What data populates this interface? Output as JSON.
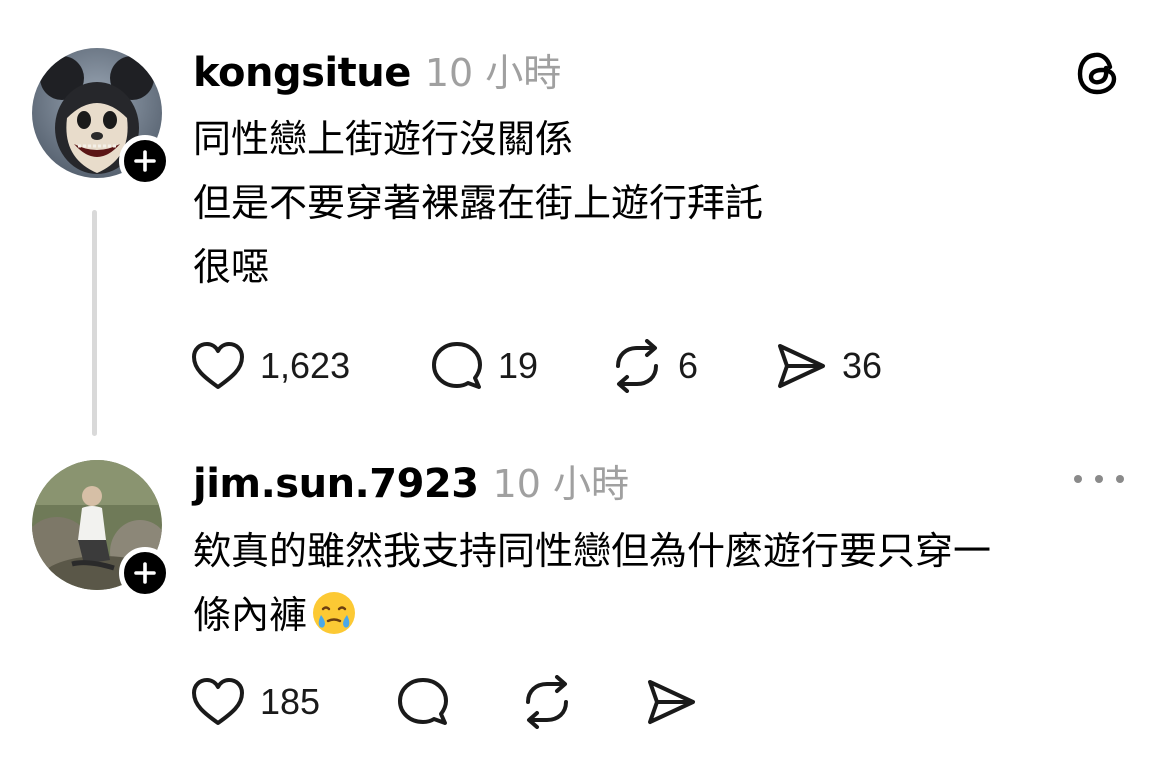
{
  "posts": [
    {
      "username": "kongsitue",
      "timestamp": "10 小時",
      "avatar_icon": "mouse-mask-avatar",
      "body_lines": [
        "同性戀上街遊行沒關係",
        "但是不要穿著裸露在街上遊行拜託",
        "很噁"
      ],
      "likes": "1,623",
      "comments": "19",
      "reposts": "6",
      "shares": "36"
    },
    {
      "username": "jim.sun.7923",
      "timestamp": "10 小時",
      "avatar_icon": "person-photo-avatar",
      "body_lines": [
        "欸真的雖然我支持同性戀但為什麼遊行要只穿一",
        "條內褲"
      ],
      "body_emoji": "face-holding-back-tears-emoji",
      "likes": "185"
    }
  ],
  "icons": {
    "follow": "plus-icon",
    "app_logo": "threads-logo-icon",
    "more": "more-icon",
    "like": "heart-icon",
    "comment": "comment-icon",
    "repost": "repost-icon",
    "share": "share-icon"
  },
  "colors": {
    "text": "#000000",
    "muted": "#a0a0a0",
    "thread_line": "#d9d9d9",
    "badge": "#000000"
  }
}
